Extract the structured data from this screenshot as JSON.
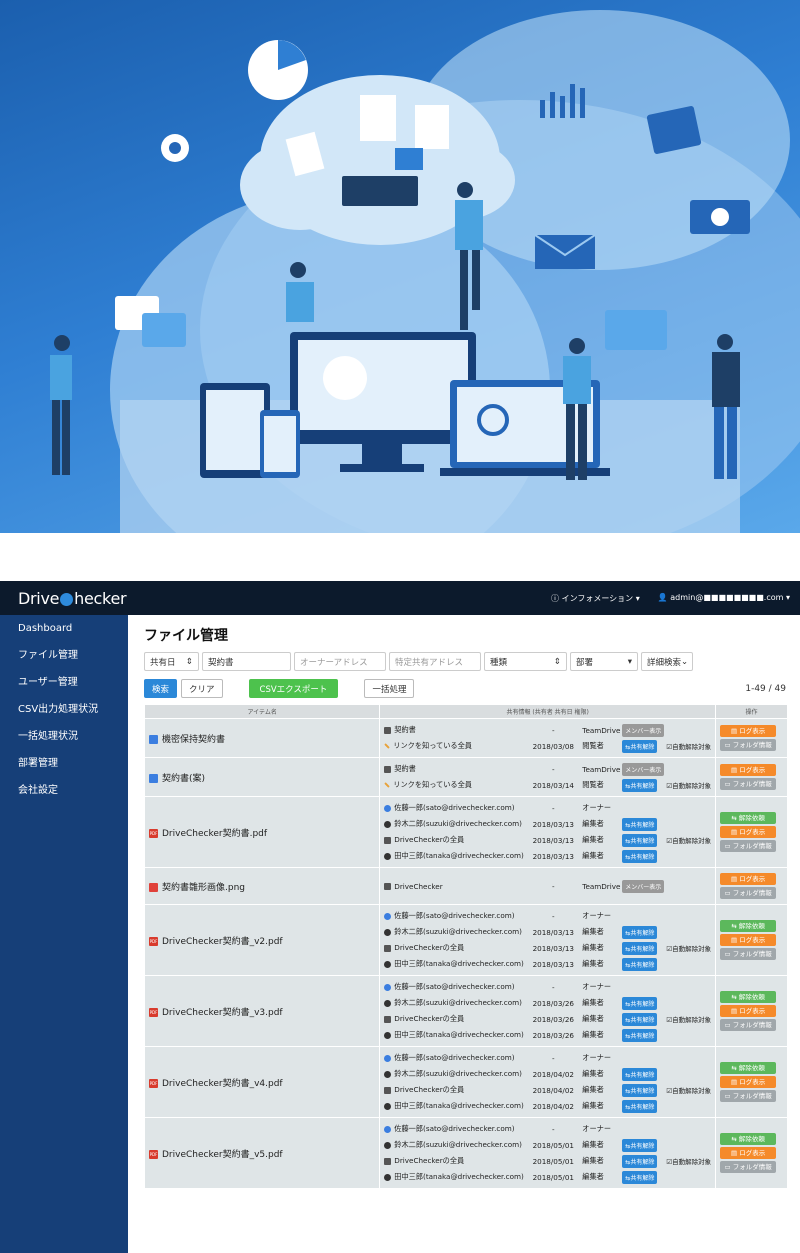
{
  "app": {
    "logo": "DriveChecker",
    "logo_left": "Drive",
    "logo_right": "hecker",
    "info_menu": "インフォメーション",
    "account": "admin@■■■■■■■■.com"
  },
  "sidebar": {
    "items": [
      {
        "label": "Dashboard"
      },
      {
        "label": "ファイル管理"
      },
      {
        "label": "ユーザー管理"
      },
      {
        "label": "CSV出力処理状況"
      },
      {
        "label": "一括処理状況"
      },
      {
        "label": "部署管理"
      },
      {
        "label": "会社設定"
      }
    ]
  },
  "main": {
    "title": "ファイル管理",
    "filters": {
      "share_date": "共有日",
      "keyword": "契約書",
      "owner_placeholder": "オーナーアドレス",
      "shared_placeholder": "特定共有アドレス",
      "type": "種類",
      "dept": "部署",
      "advanced": "詳細検索"
    },
    "buttons": {
      "search": "検索",
      "clear": "クリア",
      "csv": "CSVエクスポート",
      "bulk": "一括処理"
    },
    "count": "1-49 / 49",
    "columns": {
      "item": "アイテム名",
      "share": "共有情報 (共有者 共有日 権限)",
      "ops": "操作"
    },
    "labels": {
      "member_view": "メンバー表示",
      "unshare": "共有解除",
      "auto_unshare": "自動解除対象",
      "log": "ログ表示",
      "folder": "フォルダ情報",
      "release": "解除依頼"
    },
    "rows": [
      {
        "name": "機密保持契約書",
        "icon": "doc",
        "release": false,
        "shares": [
          {
            "kind": "drive",
            "name": "契約書",
            "date": "-",
            "role": "TeamDrive",
            "btn": "member"
          },
          {
            "kind": "link",
            "name": "リンクを知っている全員",
            "date": "2018/03/08",
            "role": "閲覧者",
            "btn": "unshare",
            "auto": true
          }
        ]
      },
      {
        "name": "契約書(案)",
        "icon": "doc",
        "release": false,
        "shares": [
          {
            "kind": "drive",
            "name": "契約書",
            "date": "-",
            "role": "TeamDrive",
            "btn": "member"
          },
          {
            "kind": "link",
            "name": "リンクを知っている全員",
            "date": "2018/03/14",
            "role": "閲覧者",
            "btn": "unshare",
            "auto": true
          }
        ]
      },
      {
        "name": "DriveChecker契約書.pdf",
        "icon": "pdf",
        "release": true,
        "shares": [
          {
            "kind": "owner",
            "name": "佐藤一郎(sato@drivechecker.com)",
            "date": "-",
            "role": "オーナー",
            "btn": ""
          },
          {
            "kind": "user",
            "name": "鈴木二郎(suzuki@drivechecker.com)",
            "date": "2018/03/13",
            "role": "編集者",
            "btn": "unshare"
          },
          {
            "kind": "group",
            "name": "DriveCheckerの全員",
            "date": "2018/03/13",
            "role": "編集者",
            "btn": "unshare",
            "auto": true
          },
          {
            "kind": "user",
            "name": "田中三郎(tanaka@drivechecker.com)",
            "date": "2018/03/13",
            "role": "編集者",
            "btn": "unshare"
          }
        ]
      },
      {
        "name": "契約書雛形画像.png",
        "icon": "img",
        "release": false,
        "shares": [
          {
            "kind": "drive",
            "name": "DriveChecker",
            "date": "-",
            "role": "TeamDrive",
            "btn": "member"
          }
        ]
      },
      {
        "name": "DriveChecker契約書_v2.pdf",
        "icon": "pdf",
        "release": true,
        "shares": [
          {
            "kind": "owner",
            "name": "佐藤一郎(sato@drivechecker.com)",
            "date": "-",
            "role": "オーナー",
            "btn": ""
          },
          {
            "kind": "user",
            "name": "鈴木二郎(suzuki@drivechecker.com)",
            "date": "2018/03/13",
            "role": "編集者",
            "btn": "unshare"
          },
          {
            "kind": "group",
            "name": "DriveCheckerの全員",
            "date": "2018/03/13",
            "role": "編集者",
            "btn": "unshare",
            "auto": true
          },
          {
            "kind": "user",
            "name": "田中三郎(tanaka@drivechecker.com)",
            "date": "2018/03/13",
            "role": "編集者",
            "btn": "unshare"
          }
        ]
      },
      {
        "name": "DriveChecker契約書_v3.pdf",
        "icon": "pdf",
        "release": true,
        "shares": [
          {
            "kind": "owner",
            "name": "佐藤一郎(sato@drivechecker.com)",
            "date": "-",
            "role": "オーナー",
            "btn": ""
          },
          {
            "kind": "user",
            "name": "鈴木二郎(suzuki@drivechecker.com)",
            "date": "2018/03/26",
            "role": "編集者",
            "btn": "unshare"
          },
          {
            "kind": "group",
            "name": "DriveCheckerの全員",
            "date": "2018/03/26",
            "role": "編集者",
            "btn": "unshare",
            "auto": true
          },
          {
            "kind": "user",
            "name": "田中三郎(tanaka@drivechecker.com)",
            "date": "2018/03/26",
            "role": "編集者",
            "btn": "unshare"
          }
        ]
      },
      {
        "name": "DriveChecker契約書_v4.pdf",
        "icon": "pdf",
        "release": true,
        "shares": [
          {
            "kind": "owner",
            "name": "佐藤一郎(sato@drivechecker.com)",
            "date": "-",
            "role": "オーナー",
            "btn": ""
          },
          {
            "kind": "user",
            "name": "鈴木二郎(suzuki@drivechecker.com)",
            "date": "2018/04/02",
            "role": "編集者",
            "btn": "unshare"
          },
          {
            "kind": "group",
            "name": "DriveCheckerの全員",
            "date": "2018/04/02",
            "role": "編集者",
            "btn": "unshare",
            "auto": true
          },
          {
            "kind": "user",
            "name": "田中三郎(tanaka@drivechecker.com)",
            "date": "2018/04/02",
            "role": "編集者",
            "btn": "unshare"
          }
        ]
      },
      {
        "name": "DriveChecker契約書_v5.pdf",
        "icon": "pdf",
        "release": true,
        "shares": [
          {
            "kind": "owner",
            "name": "佐藤一郎(sato@drivechecker.com)",
            "date": "-",
            "role": "オーナー",
            "btn": ""
          },
          {
            "kind": "user",
            "name": "鈴木二郎(suzuki@drivechecker.com)",
            "date": "2018/05/01",
            "role": "編集者",
            "btn": "unshare"
          },
          {
            "kind": "group",
            "name": "DriveCheckerの全員",
            "date": "2018/05/01",
            "role": "編集者",
            "btn": "unshare",
            "auto": true
          },
          {
            "kind": "user",
            "name": "田中三郎(tanaka@drivechecker.com)",
            "date": "2018/05/01",
            "role": "編集者",
            "btn": "unshare"
          }
        ]
      }
    ]
  }
}
